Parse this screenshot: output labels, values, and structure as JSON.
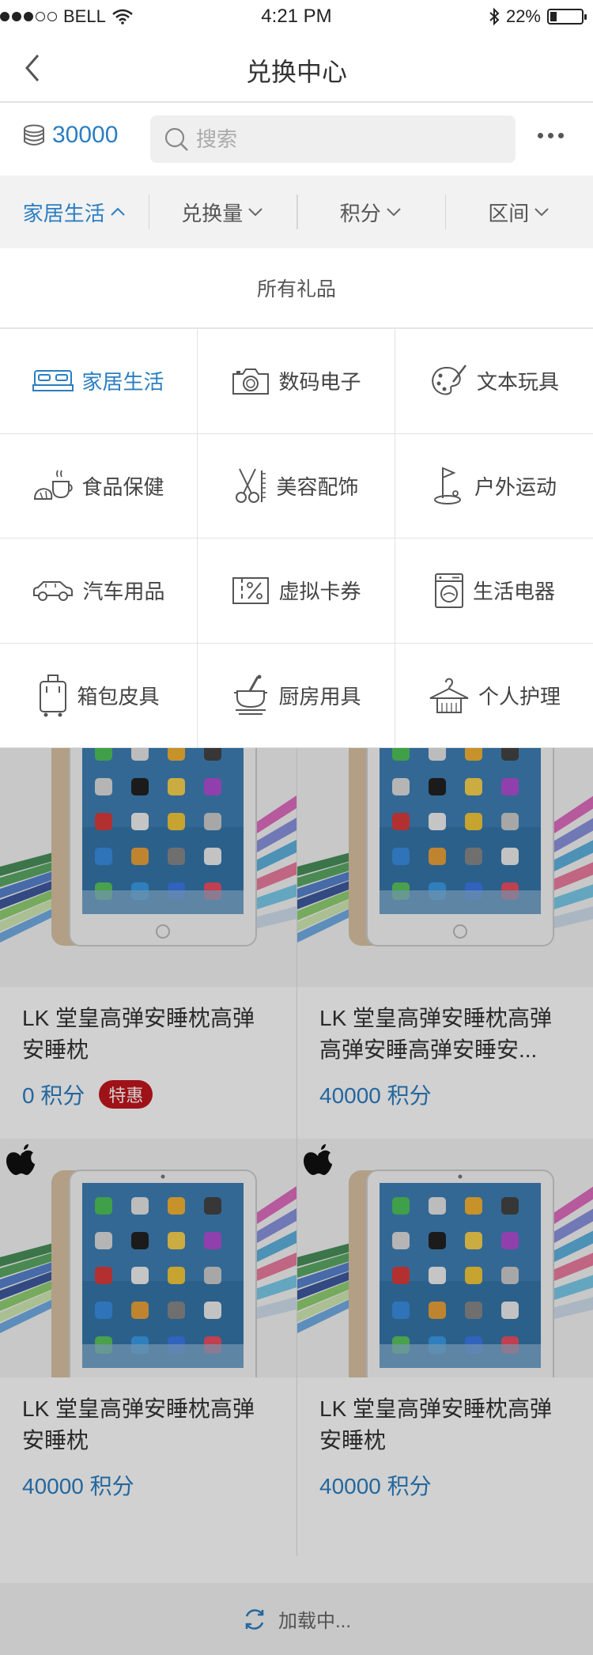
{
  "status_bar": {
    "carrier": "BELL",
    "time": "4:21 PM",
    "battery": "22%",
    "battery_level": 0.22
  },
  "nav": {
    "title": "兑换中心"
  },
  "points": {
    "value": "30000"
  },
  "search": {
    "placeholder": "搜索"
  },
  "filters": [
    {
      "label": "家居生活"
    },
    {
      "label": "兑换量"
    },
    {
      "label": "积分"
    },
    {
      "label": "区间"
    }
  ],
  "all_gifts": "所有礼品",
  "categories": [
    {
      "label": "家居生活",
      "icon": "bed-icon"
    },
    {
      "label": "数码电子",
      "icon": "camera-icon"
    },
    {
      "label": "文本玩具",
      "icon": "palette-icon"
    },
    {
      "label": "食品保健",
      "icon": "food-icon"
    },
    {
      "label": "美容配饰",
      "icon": "scissors-icon"
    },
    {
      "label": "户外运动",
      "icon": "golf-flag-icon"
    },
    {
      "label": "汽车用品",
      "icon": "car-icon"
    },
    {
      "label": "虚拟卡券",
      "icon": "coupon-icon"
    },
    {
      "label": "生活电器",
      "icon": "washing-machine-icon"
    },
    {
      "label": "箱包皮具",
      "icon": "suitcase-icon"
    },
    {
      "label": "厨房用具",
      "icon": "kitchen-icon"
    },
    {
      "label": "个人护理",
      "icon": "hanger-icon"
    }
  ],
  "products": [
    {
      "name": "LK 堂皇高弹安睡枕高弹安睡枕",
      "price": "0 积分",
      "badge": "特惠"
    },
    {
      "name": "LK 堂皇高弹安睡枕高弹高弹安睡高弹安睡安...",
      "price": "40000 积分"
    },
    {
      "name": "LK 堂皇高弹安睡枕高弹安睡枕",
      "price": "40000 积分"
    },
    {
      "name": "LK 堂皇高弹安睡枕高弹安睡枕",
      "price": "40000 积分"
    }
  ],
  "loading": "加载中...",
  "colors": {
    "accent": "#2b7ec1",
    "badge": "#c3171e"
  }
}
